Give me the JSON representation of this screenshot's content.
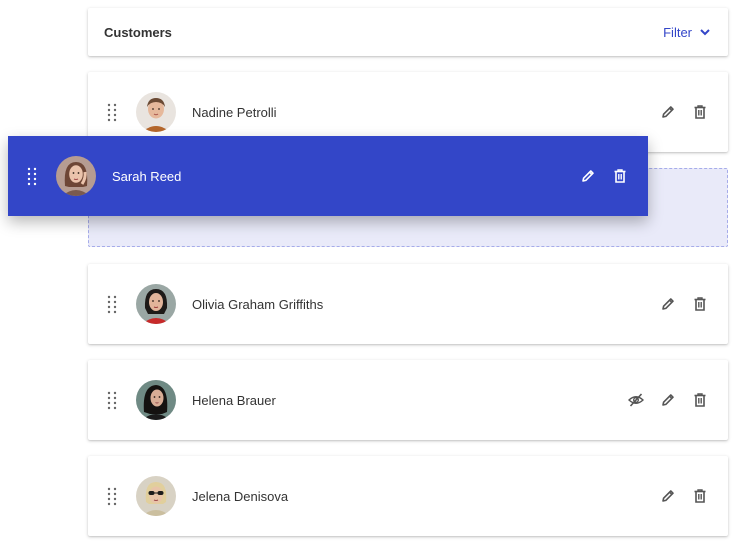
{
  "header": {
    "title": "Customers",
    "filter_label": "Filter"
  },
  "colors": {
    "accent": "#3346c8",
    "placeholder_bg": "#e9eaf9",
    "icon": "#555555"
  },
  "customers": [
    {
      "name": "Nadine Petrolli",
      "avatar": "avatar-nadine",
      "hidden_toggle": false
    },
    {
      "name": "Sarah Reed",
      "avatar": "avatar-sarah",
      "dragging": true
    },
    {
      "name": "Olivia Graham Griffiths",
      "avatar": "avatar-olivia",
      "hidden_toggle": false
    },
    {
      "name": "Helena Brauer",
      "avatar": "avatar-helena",
      "hidden_toggle": true
    },
    {
      "name": "Jelena Denisova",
      "avatar": "avatar-jelena",
      "hidden_toggle": false
    }
  ]
}
